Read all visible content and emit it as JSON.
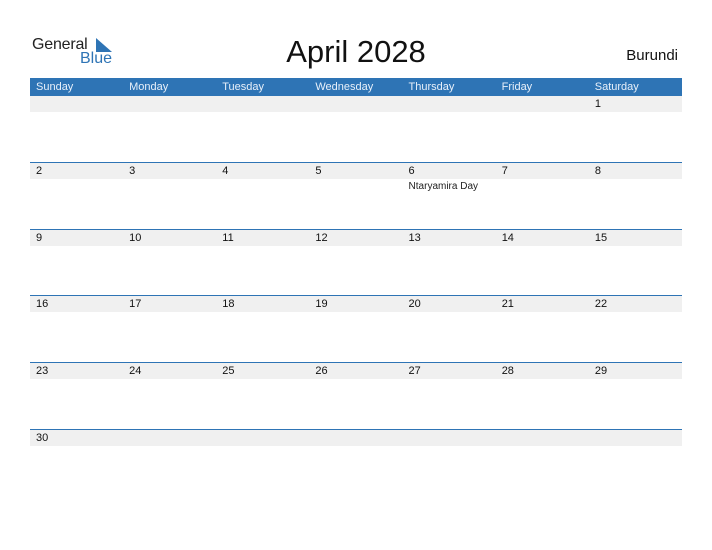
{
  "logo": {
    "line1": "General",
    "line2": "Blue",
    "brand_color": "#2e74b5"
  },
  "title": "April 2028",
  "country": "Burundi",
  "colors": {
    "header_bg": "#2e74b5",
    "row_band": "#f0f0f0"
  },
  "day_names": [
    "Sunday",
    "Monday",
    "Tuesday",
    "Wednesday",
    "Thursday",
    "Friday",
    "Saturday"
  ],
  "weeks": [
    [
      "",
      "",
      "",
      "",
      "",
      "",
      "1"
    ],
    [
      "2",
      "3",
      "4",
      "5",
      "6",
      "7",
      "8"
    ],
    [
      "9",
      "10",
      "11",
      "12",
      "13",
      "14",
      "15"
    ],
    [
      "16",
      "17",
      "18",
      "19",
      "20",
      "21",
      "22"
    ],
    [
      "23",
      "24",
      "25",
      "26",
      "27",
      "28",
      "29"
    ],
    [
      "30",
      "",
      "",
      "",
      "",
      "",
      ""
    ]
  ],
  "events": [
    {
      "week": 1,
      "day": 4,
      "label": "Ntaryamira Day"
    }
  ]
}
